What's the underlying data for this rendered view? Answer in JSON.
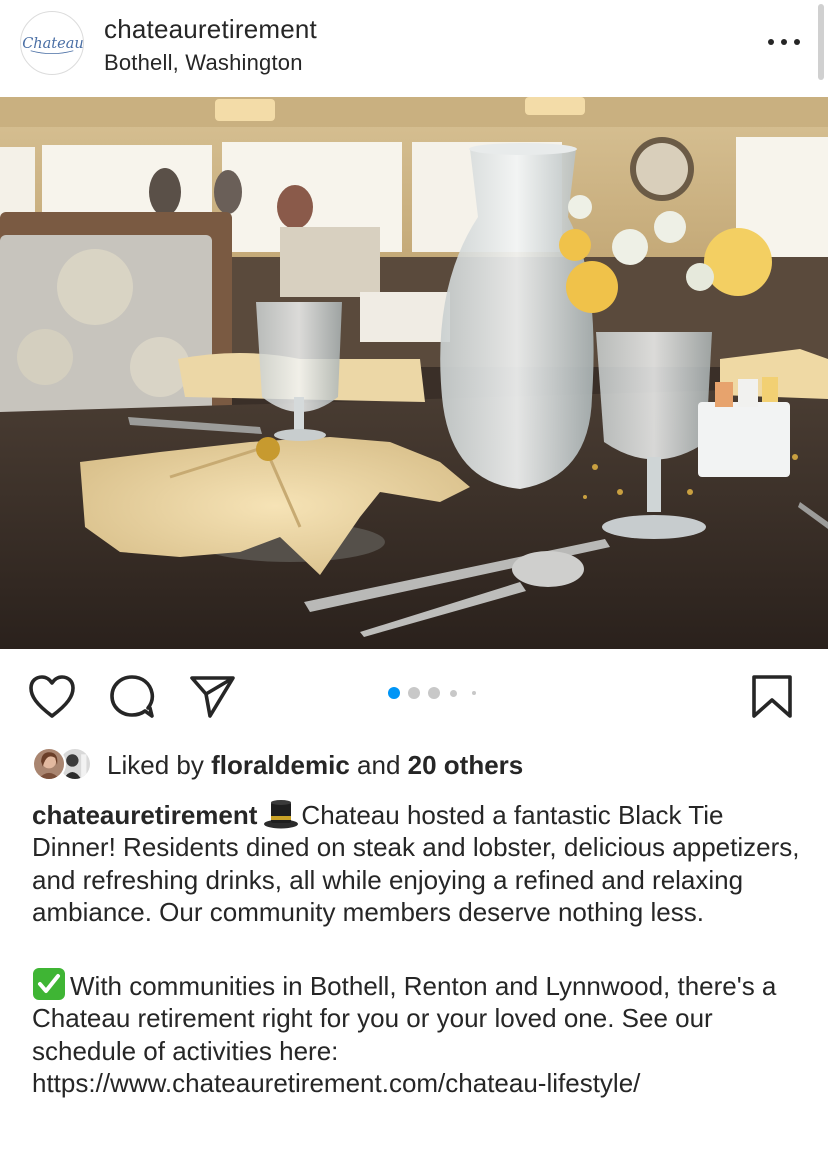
{
  "post": {
    "username": "chateauretirement",
    "location": "Bothell, Washington",
    "avatar_logo_text": "Chateau"
  },
  "icons": {
    "more": "more-horizontal-icon",
    "like": "heart-icon",
    "comment": "comment-bubble-icon",
    "share": "paper-plane-icon",
    "save": "bookmark-icon",
    "hat_emoji": "top-hat-emoji",
    "check_emoji": "check-mark-emoji"
  },
  "carousel": {
    "total_dots": 5,
    "active_index": 0,
    "active_color": "#0095f6"
  },
  "likes": {
    "prefix": "Liked by",
    "user": "floraldemic",
    "connector": "and",
    "others": "20 others"
  },
  "caption": {
    "author": "chateauretirement",
    "paragraph1": "Chateau hosted a fantastic Black Tie Dinner! Residents dined on steak and lobster, delicious appetizers, and refreshing drinks, all while enjoying a refined and relaxing ambiance. Our community members deserve nothing less.",
    "paragraph2_line1": "With communities in Bothell, Renton and Lynnwood,",
    "paragraph2_rest": "there's a Chateau retirement right for you or your loved one. See our schedule of activities here:",
    "link": "https://www.chateauretirement.com/chateau-lifestyle/"
  }
}
